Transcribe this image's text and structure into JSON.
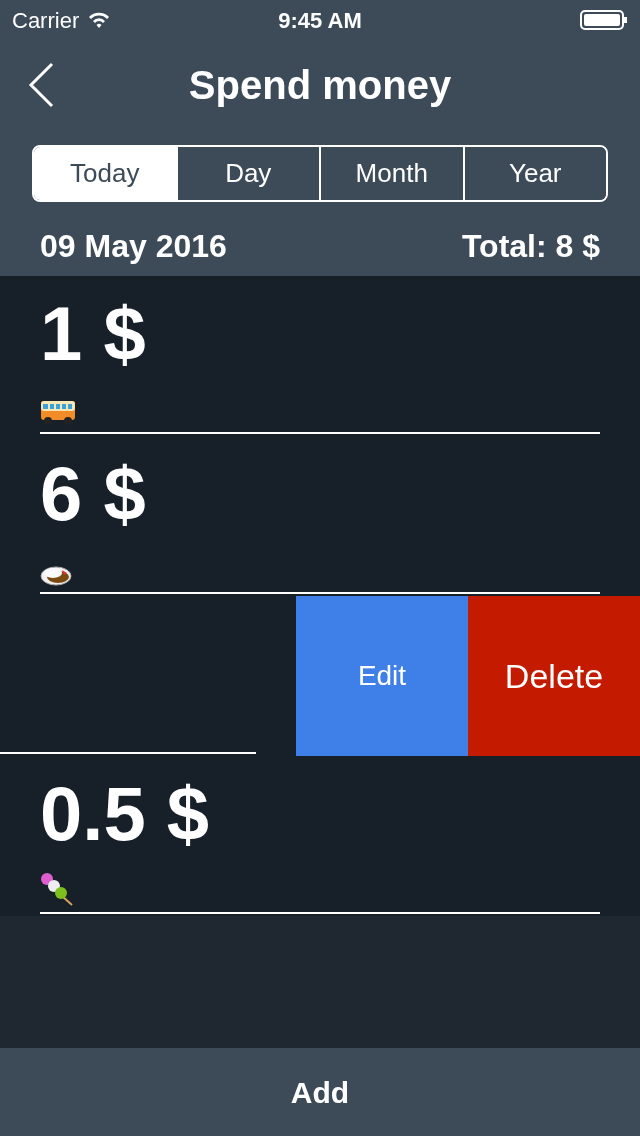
{
  "status_bar": {
    "carrier": "Carrier",
    "time": "9:45 AM"
  },
  "nav": {
    "title": "Spend money"
  },
  "tabs": [
    {
      "label": "Today",
      "selected": true
    },
    {
      "label": "Day",
      "selected": false
    },
    {
      "label": "Month",
      "selected": false
    },
    {
      "label": "Year",
      "selected": false
    }
  ],
  "summary": {
    "date": "09 May 2016",
    "total": "Total: 8 $"
  },
  "entries": [
    {
      "kind": "expense",
      "amount": "1 $"
    },
    {
      "kind": "expense",
      "amount": "6 $"
    },
    {
      "kind": "swiped",
      "actions": [
        {
          "kind": "edit",
          "label": "Edit"
        },
        {
          "kind": "delete",
          "label": "Delete"
        }
      ]
    },
    {
      "kind": "expense",
      "amount": "0.5 $"
    }
  ],
  "footer": {
    "button": "Add"
  }
}
